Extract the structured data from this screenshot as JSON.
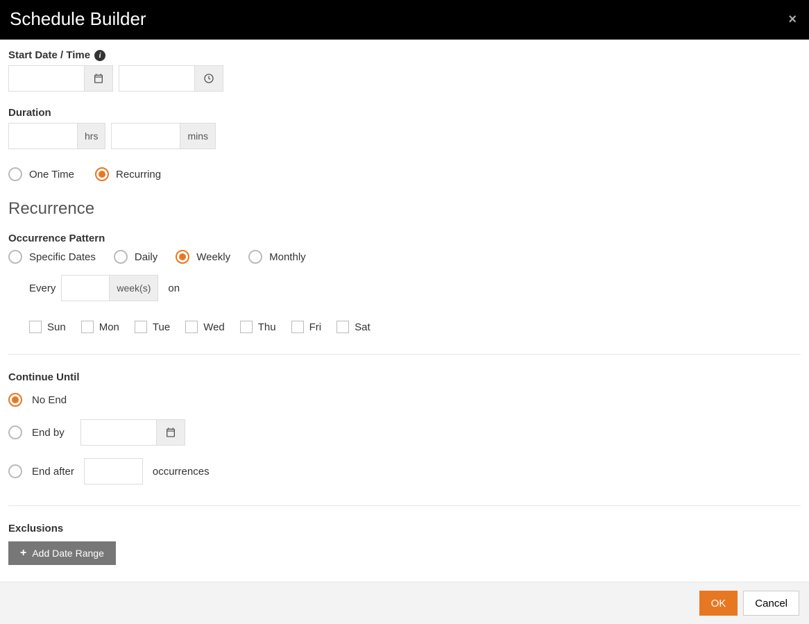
{
  "header": {
    "title": "Schedule Builder"
  },
  "start": {
    "label": "Start Date / Time",
    "date_value": "",
    "time_value": ""
  },
  "duration": {
    "label": "Duration",
    "hrs_value": "",
    "hrs_suffix": "hrs",
    "mins_value": "",
    "mins_suffix": "mins"
  },
  "freq": {
    "one_time": "One Time",
    "recurring": "Recurring"
  },
  "recurrence_heading": "Recurrence",
  "pattern": {
    "label": "Occurrence Pattern",
    "specific": "Specific Dates",
    "daily": "Daily",
    "weekly": "Weekly",
    "monthly": "Monthly"
  },
  "weekly": {
    "every": "Every",
    "interval_value": "",
    "unit": "week(s)",
    "on": "on",
    "days": [
      "Sun",
      "Mon",
      "Tue",
      "Wed",
      "Thu",
      "Fri",
      "Sat"
    ]
  },
  "continue": {
    "label": "Continue Until",
    "no_end": "No End",
    "end_by": "End by",
    "end_by_value": "",
    "end_after": "End after",
    "end_after_value": "",
    "occurrences": "occurrences"
  },
  "exclusions": {
    "label": "Exclusions",
    "add_button": "Add Date Range"
  },
  "footer": {
    "ok": "OK",
    "cancel": "Cancel"
  }
}
